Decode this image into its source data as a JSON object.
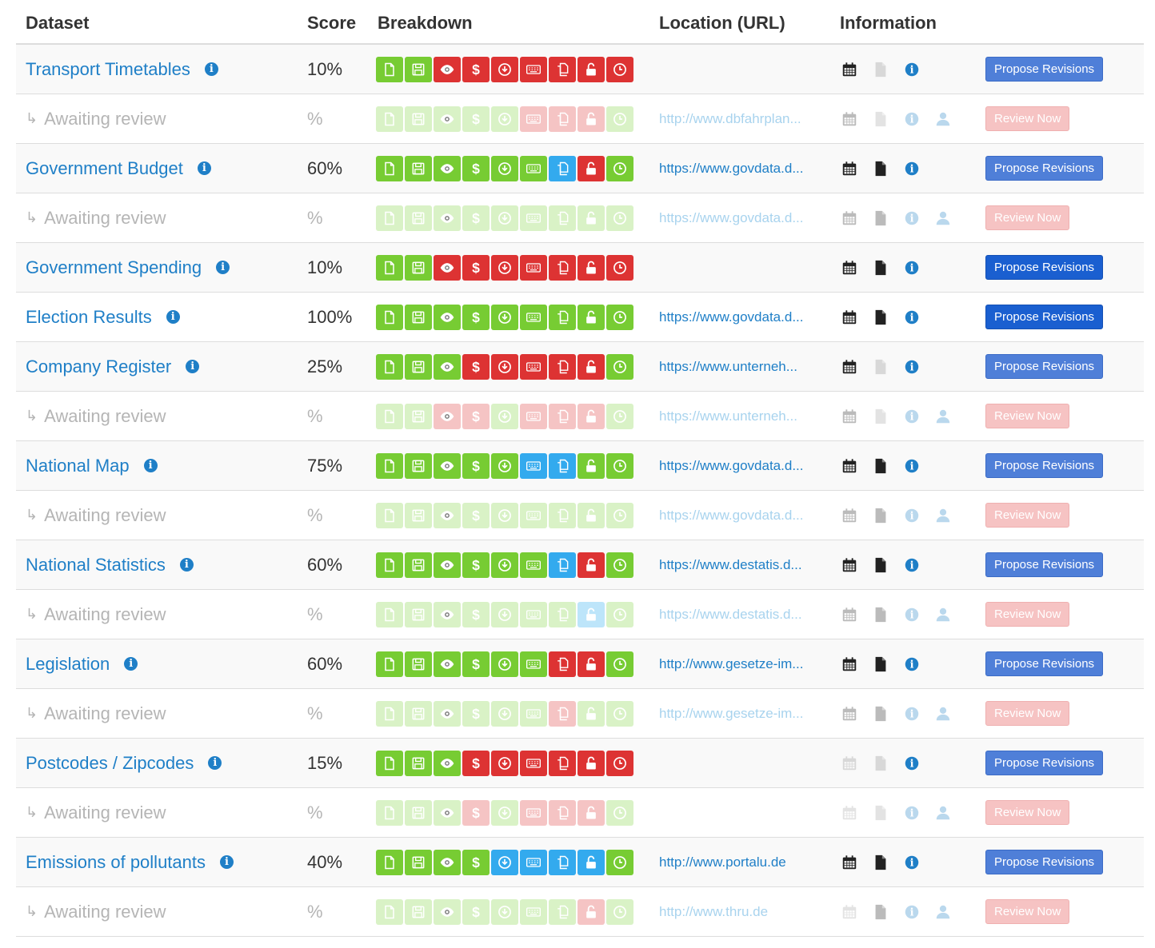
{
  "headers": {
    "dataset": "Dataset",
    "score": "Score",
    "breakdown": "Breakdown",
    "location": "Location (URL)",
    "information": "Information"
  },
  "labels": {
    "awaiting": "Awaiting review",
    "propose": "Propose Revisions",
    "review": "Review Now",
    "pending_score": "%"
  },
  "colors": {
    "green": "#77cc33",
    "red": "#dd3333",
    "blue": "#33aaee",
    "link": "#1f7fc7"
  },
  "breakdown_icons": [
    "file-icon",
    "save-icon",
    "eye-icon",
    "dollar-icon",
    "download-icon",
    "keyboard-icon",
    "copy-icon",
    "unlock-icon",
    "clock-icon"
  ],
  "rows": [
    {
      "type": "dataset",
      "name": "Transport Timetables",
      "score": "10%",
      "url": "",
      "badges": [
        "green",
        "green",
        "red",
        "red",
        "red",
        "red",
        "red",
        "red",
        "red"
      ],
      "info": [
        1,
        0.3,
        1,
        0
      ],
      "button": "normal"
    },
    {
      "type": "pending",
      "url": "http://www.dbfahrplan...",
      "badges": [
        "green",
        "green",
        "green",
        "green",
        "green",
        "red",
        "red",
        "red",
        "green"
      ],
      "info": [
        1,
        0.3,
        1,
        1
      ]
    },
    {
      "type": "dataset",
      "name": "Government Budget",
      "score": "60%",
      "url": "https://www.govdata.d...",
      "badges": [
        "green",
        "green",
        "green",
        "green",
        "green",
        "green",
        "blue",
        "red",
        "green"
      ],
      "info": [
        1,
        1,
        1,
        0
      ],
      "button": "normal"
    },
    {
      "type": "pending",
      "url": "https://www.govdata.d...",
      "badges": [
        "green",
        "green",
        "green",
        "green",
        "green",
        "green",
        "green",
        "green",
        "green"
      ],
      "info": [
        1,
        1,
        1,
        1
      ]
    },
    {
      "type": "dataset",
      "name": "Government Spending",
      "score": "10%",
      "url": "",
      "badges": [
        "green",
        "green",
        "red",
        "red",
        "red",
        "red",
        "red",
        "red",
        "red"
      ],
      "info": [
        1,
        1,
        1,
        0
      ],
      "button": "dark"
    },
    {
      "type": "dataset",
      "name": "Election Results",
      "score": "100%",
      "url": "https://www.govdata.d...",
      "badges": [
        "green",
        "green",
        "green",
        "green",
        "green",
        "green",
        "green",
        "green",
        "green"
      ],
      "info": [
        1,
        1,
        1,
        0
      ],
      "button": "dark"
    },
    {
      "type": "dataset",
      "name": "Company Register",
      "score": "25%",
      "url": "https://www.unterneh...",
      "badges": [
        "green",
        "green",
        "green",
        "red",
        "red",
        "red",
        "red",
        "red",
        "green"
      ],
      "info": [
        1,
        0.3,
        1,
        0
      ],
      "button": "normal"
    },
    {
      "type": "pending",
      "url": "https://www.unterneh...",
      "badges": [
        "green",
        "green",
        "red",
        "red",
        "green",
        "red",
        "red",
        "red",
        "green"
      ],
      "info": [
        1,
        0.3,
        1,
        1
      ]
    },
    {
      "type": "dataset",
      "name": "National Map",
      "score": "75%",
      "url": "https://www.govdata.d...",
      "badges": [
        "green",
        "green",
        "green",
        "green",
        "green",
        "blue",
        "blue",
        "green",
        "green"
      ],
      "info": [
        1,
        1,
        1,
        0
      ],
      "button": "normal"
    },
    {
      "type": "pending",
      "url": "https://www.govdata.d...",
      "badges": [
        "green",
        "green",
        "green",
        "green",
        "green",
        "green",
        "green",
        "green",
        "green"
      ],
      "info": [
        1,
        1,
        1,
        1
      ]
    },
    {
      "type": "dataset",
      "name": "National Statistics",
      "score": "60%",
      "url": "https://www.destatis.d...",
      "badges": [
        "green",
        "green",
        "green",
        "green",
        "green",
        "green",
        "blue",
        "red",
        "green"
      ],
      "info": [
        1,
        1,
        1,
        0
      ],
      "button": "normal"
    },
    {
      "type": "pending",
      "url": "https://www.destatis.d...",
      "badges": [
        "green",
        "green",
        "green",
        "green",
        "green",
        "green",
        "green",
        "blue",
        "green"
      ],
      "info": [
        1,
        1,
        1,
        1
      ]
    },
    {
      "type": "dataset",
      "name": "Legislation",
      "score": "60%",
      "url": "http://www.gesetze-im...",
      "badges": [
        "green",
        "green",
        "green",
        "green",
        "green",
        "green",
        "red",
        "red",
        "green"
      ],
      "info": [
        1,
        1,
        1,
        0
      ],
      "button": "normal"
    },
    {
      "type": "pending",
      "url": "http://www.gesetze-im...",
      "badges": [
        "green",
        "green",
        "green",
        "green",
        "green",
        "green",
        "red",
        "green",
        "green"
      ],
      "info": [
        1,
        1,
        1,
        1
      ]
    },
    {
      "type": "dataset",
      "name": "Postcodes / Zipcodes",
      "score": "15%",
      "url": "",
      "badges": [
        "green",
        "green",
        "green",
        "red",
        "red",
        "red",
        "red",
        "red",
        "red"
      ],
      "info": [
        0.3,
        0.3,
        1,
        0
      ],
      "button": "normal"
    },
    {
      "type": "pending",
      "url": "",
      "badges": [
        "green",
        "green",
        "green",
        "red",
        "green",
        "red",
        "red",
        "red",
        "green"
      ],
      "info": [
        0.3,
        0.3,
        1,
        1
      ]
    },
    {
      "type": "dataset",
      "name": "Emissions of pollutants",
      "score": "40%",
      "url": "http://www.portalu.de",
      "badges": [
        "green",
        "green",
        "green",
        "green",
        "blue",
        "blue",
        "blue",
        "blue",
        "green"
      ],
      "info": [
        1,
        1,
        1,
        0
      ],
      "button": "normal"
    },
    {
      "type": "pending",
      "url": "http://www.thru.de",
      "badges": [
        "green",
        "green",
        "green",
        "green",
        "green",
        "green",
        "green",
        "red",
        "green"
      ],
      "info": [
        0.3,
        1,
        1,
        1
      ]
    }
  ]
}
